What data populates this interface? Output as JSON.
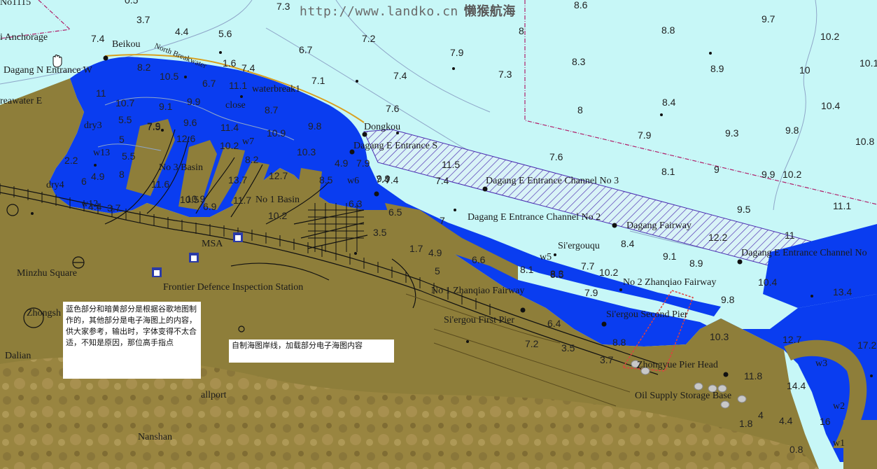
{
  "watermark": {
    "url": "http://www.landko.cn",
    "site_name": "懒猴航海"
  },
  "notes": {
    "google_note": "蓝色部分和暗黄部分是根据谷歌地图制作的，其他部分是电子海图上的内容，供大家参考，输出时，字体变得不太合适，不知是原因，那位高手指点",
    "coastline_note": "自制海图岸线，加载部分电子海图内容"
  },
  "labels": {
    "no1115": "No1115",
    "anchorage": "i Anchorage",
    "beikou": "Beikou",
    "north_breakwater": "North Breakwater",
    "dagang_n_entrance_w": "Dagang N Entrance W",
    "breakwater_e": "reawater E",
    "waterbreak1": "waterbreak1",
    "close": "close",
    "dry3": "dry3",
    "w13": "w13",
    "dry4": "dry4",
    "w12": "w12",
    "w7": "w7",
    "w6": "w6",
    "w5": "w5",
    "w3": "w3",
    "w2": "w2",
    "w1": "w1",
    "no3_basin": "No 3 Basin",
    "no1_basin": "No 1 Basin",
    "dongkou": "Dongkou",
    "dagang_e_entrance_s": "Dagang E Entrance S",
    "channel3": "Dagang E Entrance Channel No 3",
    "channel2": "Dagang E Entrance Channel No 2",
    "channel_right": "Dagang E Entrance Channel No",
    "dagang_fairway": "Dagang Fairway",
    "siergouqu": "Si'ergouqu",
    "minzhu_square": "Minzhu Square",
    "frontier": "Frontier Defence Inspection Station",
    "zhanqiao1": "No 1 Zhanqiao Fairway",
    "zhanqiao2": "No 2 Zhanqiao Fairway",
    "siergou_first": "Si'ergou First Pier",
    "siergou_second": "Si'ergou Second Pier",
    "zhongyue": "Zhongyue Pier Head",
    "oil_supply": "Oil Supply Storage Base",
    "zhongsh": "Zhongsh",
    "dalian": "Dalian",
    "allport": "allport",
    "nanshan": "Nanshan",
    "msa": "MSA"
  },
  "soundings": [
    "0.5",
    "3.7",
    "4.4",
    "5.6",
    "7.3",
    "6.7",
    "7.2",
    "7.9",
    "7.4",
    "7.3",
    "7.1",
    "8.6",
    "8",
    "8.8",
    "9.7",
    "10.2",
    "10.1",
    "8.3",
    "8.9",
    "10",
    "10.4",
    "8",
    "8.4",
    "7.9",
    "9.3",
    "9.8",
    "10.8",
    "7.6",
    "8.1",
    "9",
    "9.9",
    "10.2",
    "9.5",
    "11.1",
    "11",
    "12.2",
    "9.1",
    "8.9",
    "8.4",
    "7.7",
    "10.2",
    "7.9",
    "10.4",
    "13.4",
    "9.8",
    "6.6",
    "6.4",
    "3.5",
    "8.8",
    "3.7",
    "10.3",
    "12.7",
    "17.2",
    "11.8",
    "14.4",
    "4",
    "4.4",
    "16",
    "1.8",
    "0.8",
    "1.7",
    "4.9",
    "5",
    "3.5",
    "7",
    "6.5",
    "6.3",
    "7.4",
    "7.9",
    "11.5",
    "7.4",
    "7.6",
    "4.9",
    "8.5",
    "9.8",
    "10.3",
    "10.9",
    "8.7",
    "11.1",
    "9.9",
    "9.1",
    "10.5",
    "8.2",
    "6.7",
    "1.6",
    "7.4",
    "7.4",
    "7.9",
    "8.1",
    "8.5",
    "7.2",
    "11.4",
    "10.2",
    "8.2",
    "12.7",
    "13.7",
    "10.9",
    "11.7",
    "10.2",
    "11",
    "10.7",
    "5.5",
    "5",
    "5.5",
    "7.5",
    "9.6",
    "12.6",
    "8",
    "2.2",
    "4.9",
    "6",
    "3.7",
    "4.4",
    "11.6",
    "10.5",
    "6.9",
    "7.4",
    "9.9",
    "8.3"
  ],
  "colors": {
    "sea": "#c7f7f7",
    "deep_water": "#0a3df0",
    "land": "#8e7e3a",
    "hills": "#a08a45",
    "channel_hatch": "#4a2cb0",
    "boundary": "#b0206a",
    "pier_line": "#e04040"
  },
  "icons": [
    "hand-cursor-icon",
    "building-icon",
    "anchor-icon",
    "light-beacon-icon",
    "storage-tank-icon",
    "minzhu-square-marker-icon"
  ]
}
